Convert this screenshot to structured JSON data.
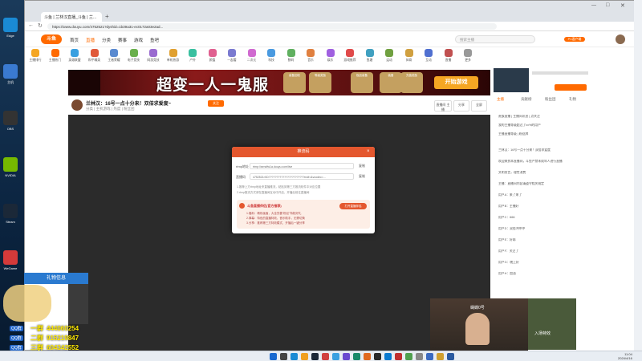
{
  "desktop": {
    "icons": [
      {
        "label": "Edge",
        "name": "edge-icon",
        "color": "#1a8ad4"
      },
      {
        "label": "主机",
        "name": "computer-icon",
        "color": "#3a7ad0"
      },
      {
        "label": "OBS",
        "name": "obs-icon",
        "color": "#333333"
      },
      {
        "label": "NVIDIA",
        "name": "nvidia-icon",
        "color": "#76b900"
      },
      {
        "label": "Steam",
        "name": "steam-icon",
        "color": "#1b2838"
      },
      {
        "label": "WeGame",
        "name": "wegame-icon",
        "color": "#d43a3a"
      }
    ]
  },
  "browser": {
    "tab_title": "斗鱼 | 兰林汉直播_斗鱼 | 兰...",
    "url": "https://www.douyu.com/4752521?dyshid=1b39a31-ec0172a03e2ad..."
  },
  "douyu": {
    "logo": "斗鱼",
    "nav": [
      "首页",
      "直播",
      "分类",
      "赛事",
      "游戏",
      "鱼吧"
    ],
    "search_placeholder": "搜索主播",
    "top_right_btn": "PC客户端",
    "categories": [
      "主播排行",
      "主播热门",
      "英雄联盟",
      "和平精英",
      "王者荣耀",
      "电子竞技",
      "网游竞技",
      "单机热游",
      "户外",
      "颜值",
      "一起看",
      "二次元",
      "科技",
      "数码",
      "音乐",
      "娱乐",
      "游戏推荐",
      "鱼塘",
      "运动",
      "体育",
      "互动",
      "直播",
      "更多"
    ]
  },
  "banner": {
    "title": "超变一人一鬼服",
    "play_btn": "开始游戏",
    "pills": [
      "装备回收",
      "等级奖励",
      "极品装备",
      "装备",
      "充值奖励"
    ]
  },
  "stream": {
    "title": "兰林汉：16号一点十分来！双倍求爱度~",
    "meta": "分类 | 主机游戏 | 热度 | 粉丝团",
    "follow": "关注",
    "btns": [
      "直播间 主播",
      "分享",
      "全屏"
    ]
  },
  "modal": {
    "title": "推流码",
    "rtmp_label": "rtmp地址",
    "rtmp_value": "rtmp://sendfw1a.douyu.com/live",
    "code_label": "直播码",
    "code_value": "4752521rXD???????????????????????mdf=&vcodec=...",
    "copy": "复制",
    "note1": "1.推荐上方rtmp地址来直播推流，粘贴到第三方推流软件中对应位置",
    "note2": "2.rtmp推流方式请在直播间互动中开启，开播后前往直播间",
    "promo_title": "斗鱼直播伴侣(官方推荐)",
    "open_btn": "打开直播伴侣",
    "promo_lines": [
      "1.福利：精彩画面，大全完善\"粉丝\"特权好礼",
      "2.弹幕：特色的直播特效，音乐助手，无需切换",
      "3.分享：推荐第三方特效模式，开播后一键分享"
    ]
  },
  "sidebar": {
    "tabs": [
      "主播",
      "贡献榜",
      "粉丝团",
      "礼物"
    ],
    "chats": [
      "贵族直播 | 主播间讯息 | 点关注",
      "我的主播等级超过了xx%的用户",
      "主播直播等级 | 粉丝牌",
      "兰林汉：16号一点十分来！双倍求爱度",
      "欢迎来到本直播间，斗鱼严禁未成年人进行直播",
      "文明发言，理性消费",
      "主播：直播间内容请遵守相关规定",
      "用户A：来了来了",
      "用户B：主播好",
      "用户C：666",
      "用户D：双倍冲冲冲",
      "用户E：好耶",
      "用户F：关注了",
      "用户G：晚上好",
      "用户H：加油"
    ]
  },
  "gift_panel": {
    "header": "礼物信息",
    "lines": [
      {
        "tag": "QQ群",
        "label": "一群",
        "value": "444060254"
      },
      {
        "tag": "QQ群",
        "label": "二群",
        "value": "915219847"
      },
      {
        "tag": "QQ群",
        "label": "三群",
        "value": "604342552"
      }
    ]
  },
  "cam": {
    "overlay": "蝴蝶0号",
    "caption": "入场特效"
  },
  "taskbar": {
    "time": "11:04",
    "date": "2024/4/16"
  }
}
